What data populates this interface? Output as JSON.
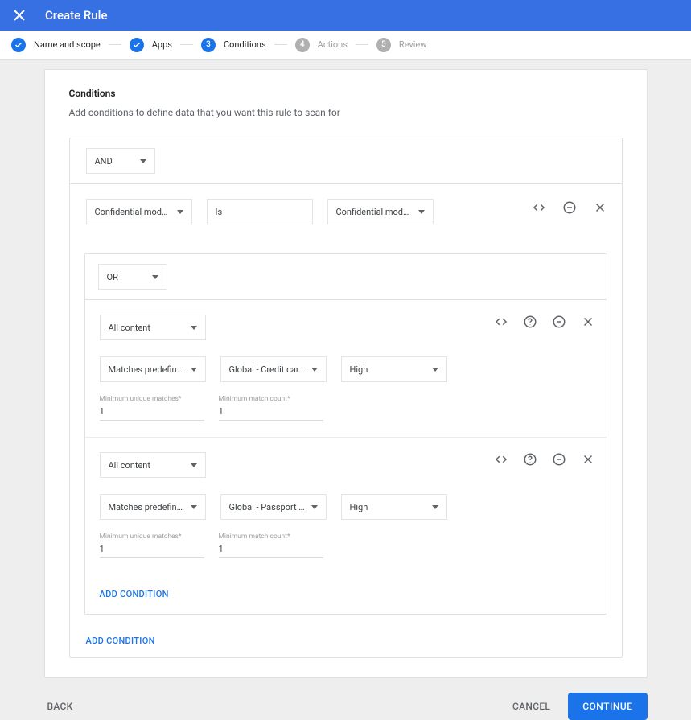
{
  "header": {
    "title": "Create Rule"
  },
  "stepper": {
    "steps": [
      {
        "label": "Name and scope",
        "state": "done"
      },
      {
        "label": "Apps",
        "state": "done"
      },
      {
        "label": "Conditions",
        "state": "current",
        "num": "3"
      },
      {
        "label": "Actions",
        "state": "future",
        "num": "4"
      },
      {
        "label": "Review",
        "state": "future",
        "num": "5"
      }
    ]
  },
  "section": {
    "title": "Conditions",
    "subtitle": "Add conditions to define data that you want this rule to scan for"
  },
  "outer": {
    "operator": "AND",
    "first_row": {
      "field": "Confidential mode st …",
      "op": "Is",
      "value": "Confidential mode dis …"
    },
    "inner": {
      "operator": "OR",
      "blocks": [
        {
          "scope": "All content",
          "match_type": "Matches predefined d …",
          "match_value": "Global - Credit card n …",
          "confidence": "High",
          "min_unique_label": "Minimum unique matches*",
          "min_unique": "1",
          "min_count_label": "Minimum match count*",
          "min_count": "1"
        },
        {
          "scope": "All content",
          "match_type": "Matches predefined d …",
          "match_value": "Global - Passport nu …",
          "confidence": "High",
          "min_unique_label": "Minimum unique matches*",
          "min_unique": "1",
          "min_count_label": "Minimum match count*",
          "min_count": "1"
        }
      ],
      "add_condition": "ADD CONDITION"
    },
    "add_condition": "ADD CONDITION"
  },
  "footer": {
    "back": "BACK",
    "cancel": "CANCEL",
    "continue": "CONTINUE"
  }
}
